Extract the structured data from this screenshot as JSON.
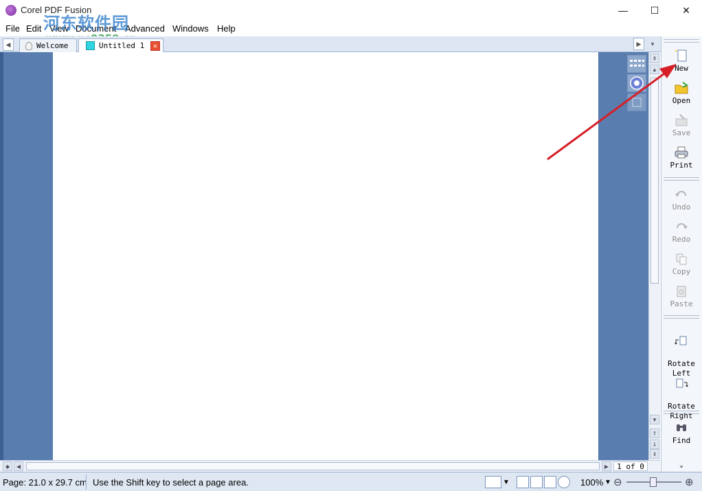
{
  "window": {
    "title": "Corel PDF Fusion",
    "controls": {
      "minimize": "—",
      "maximize": "☐",
      "close": "✕"
    }
  },
  "watermark": {
    "line1": "河东软件园",
    "line2": "www.pc0359.cn"
  },
  "menu": [
    "File",
    "Edit",
    "View",
    "Document",
    "Advanced",
    "Windows",
    "Help"
  ],
  "tabs": [
    {
      "label": "Welcome",
      "icon": "lightbulb-icon"
    },
    {
      "label": "Untitled 1",
      "icon": "document-icon",
      "active": true
    }
  ],
  "navigation": {
    "page_counter": "1 of 0"
  },
  "sidebar": {
    "groups": [
      [
        {
          "label": "New",
          "icon": "new-document-icon",
          "enabled": true
        },
        {
          "label": "Open",
          "icon": "open-folder-icon",
          "enabled": true
        },
        {
          "label": "Save",
          "icon": "save-icon",
          "enabled": false
        },
        {
          "label": "Print",
          "icon": "printer-icon",
          "enabled": true
        }
      ],
      [
        {
          "label": "Undo",
          "icon": "undo-icon",
          "enabled": false
        },
        {
          "label": "Redo",
          "icon": "redo-icon",
          "enabled": false
        },
        {
          "label": "Copy",
          "icon": "copy-icon",
          "enabled": false
        },
        {
          "label": "Paste",
          "icon": "paste-icon",
          "enabled": false
        }
      ],
      [
        {
          "label": "Rotate\nLeft",
          "icon": "rotate-left-icon",
          "enabled": true
        },
        {
          "label": "Rotate\nRight",
          "icon": "rotate-right-icon",
          "enabled": true
        }
      ],
      [
        {
          "label": "Find",
          "icon": "binoculars-icon",
          "enabled": true
        }
      ]
    ]
  },
  "status": {
    "page_size": "Page: 21.0 x 29.7 cm",
    "hint": "Use the Shift key to select a page area.",
    "zoom": "100%"
  },
  "colors": {
    "workspace": "#5a7db0",
    "chrome": "#dfe7f2",
    "annotation_arrow": "#d61f26"
  }
}
